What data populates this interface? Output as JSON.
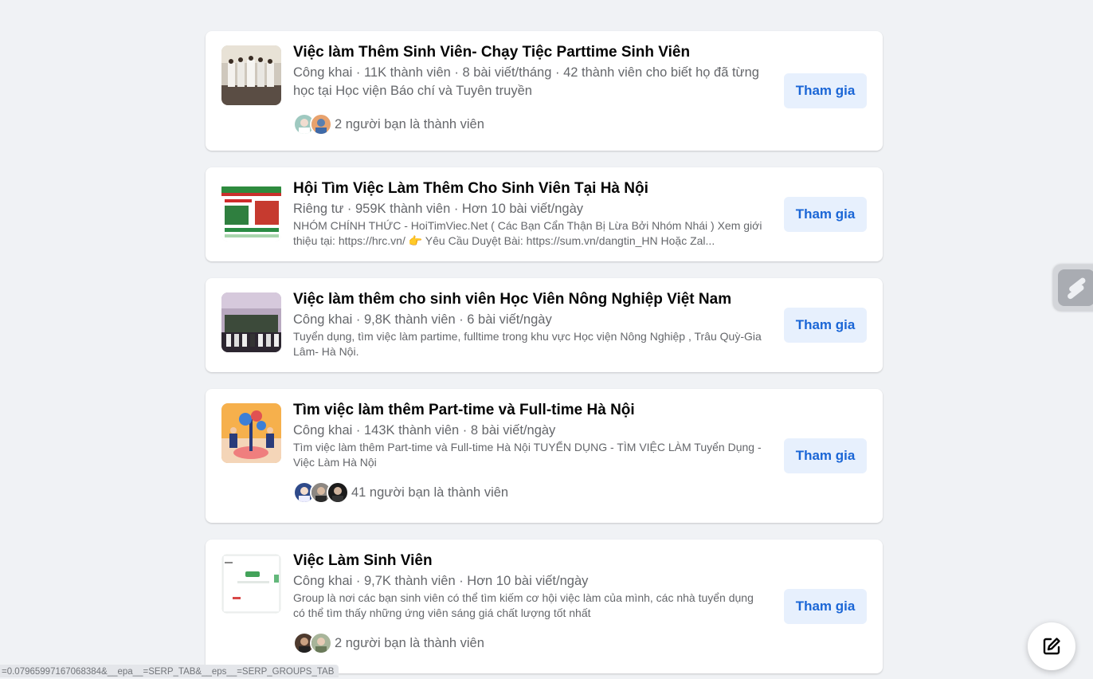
{
  "groups": [
    {
      "title": "Việc làm Thêm Sinh Viên- Chạy Tiệc Parttime Sinh Viên",
      "meta": "Công khai · 11K thành viên · 8 bài viết/tháng · 42 thành viên cho biết họ đã từng học tại Học viện Báo chí và Tuyên truyền",
      "description": "",
      "friends": "2 người bạn là thành viên",
      "join": "Tham gia"
    },
    {
      "title": "Hội Tìm Việc Làm Thêm Cho Sinh Viên Tại Hà Nội",
      "meta": "Riêng tư · 959K thành viên · Hơn 10 bài viết/ngày",
      "description": "NHÓM CHÍNH THỨC - HoiTimViec.Net ( Các Bạn Cẩn Thận Bị Lừa Bởi Nhóm Nhái ) Xem giới thiệu tại: https://hrc.vn/ 👉 Yêu Cầu Duyệt Bài: https://sum.vn/dangtin_HN Hoặc Zal...",
      "friends": "",
      "join": "Tham gia"
    },
    {
      "title": "Việc làm thêm cho sinh viên Học Viên Nông Nghiệp Việt Nam",
      "meta": "Công khai · 9,8K thành viên · 6 bài viết/ngày",
      "description": "Tuyển dụng, tìm việc làm partime, fulltime trong khu vực Học viện Nông Nghiệp , Trâu Quỳ-Gia Lâm- Hà Nội.",
      "friends": "",
      "join": "Tham gia"
    },
    {
      "title": "Tìm việc làm thêm Part-time và Full-time Hà Nội",
      "meta": "Công khai · 143K thành viên · 8 bài viết/ngày",
      "description": "Tìm việc làm thêm Part-time và Full-time Hà Nội TUYỂN DỤNG - TÌM VIỆC LÀM Tuyển Dụng - Việc Làm Hà Nội",
      "friends": "41 người bạn là thành viên",
      "join": "Tham gia"
    },
    {
      "title": "Việc Làm Sinh Viên",
      "meta": "Công khai · 9,7K thành viên · Hơn 10 bài viết/ngày",
      "description": "Group là nơi các bạn sinh viên có thể tìm kiếm cơ hội việc làm của mình, các nhà tuyển dụng có thể tìm thấy những ứng viên sáng giá chất lượng tốt nhất",
      "friends": "2 người bạn là thành viên",
      "join": "Tham gia"
    }
  ],
  "status_url": "=0.07965997167068384&__epa__=SERP_TAB&__eps__=SERP_GROUPS_TAB",
  "icons": {
    "side_widget": "slash-logo-icon",
    "compose": "compose-icon"
  },
  "colors": {
    "page_bg": "#f0f2f5",
    "join_bg": "#e7f0fd",
    "join_text": "#1b66d6",
    "secondary_text": "#65676b"
  }
}
